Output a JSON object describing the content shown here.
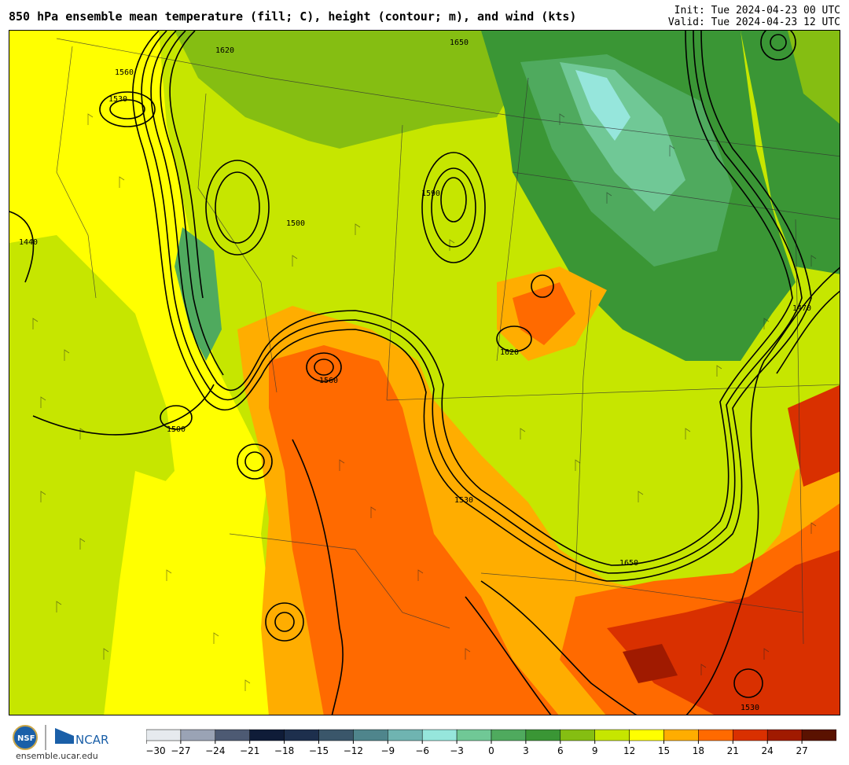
{
  "header": {
    "title": "850 hPa ensemble mean temperature (fill; C), height (contour; m), and wind (kts)",
    "init": "Init: Tue 2024-04-23 00 UTC",
    "valid": "Valid: Tue 2024-04-23 12 UTC"
  },
  "footer": {
    "org": "NCAR",
    "website": "ensemble.ucar.edu"
  },
  "colorbar": {
    "ticks": [
      "−30",
      "−27",
      "−24",
      "−21",
      "−18",
      "−15",
      "−12",
      "−9",
      "−6",
      "−3",
      "0",
      "3",
      "6",
      "9",
      "12",
      "15",
      "18",
      "21",
      "24",
      "27"
    ],
    "colors": [
      "#e6eaee",
      "#9aa3b5",
      "#4d5a73",
      "#0f1c38",
      "#1d2f4d",
      "#3a566a",
      "#4f858c",
      "#6fb4b1",
      "#96e6dc",
      "#70c896",
      "#4faa5e",
      "#3a9635",
      "#85be12",
      "#c6e600",
      "#ffff00",
      "#ffad00",
      "#ff6a00",
      "#d93000",
      "#a01a00",
      "#5a1200"
    ]
  },
  "contour_labels": [
    "1530",
    "1560",
    "1620",
    "1650",
    "1590",
    "1500",
    "1470",
    "1440",
    "1530",
    "1560",
    "1620",
    "1650",
    "1500",
    "1530"
  ]
}
